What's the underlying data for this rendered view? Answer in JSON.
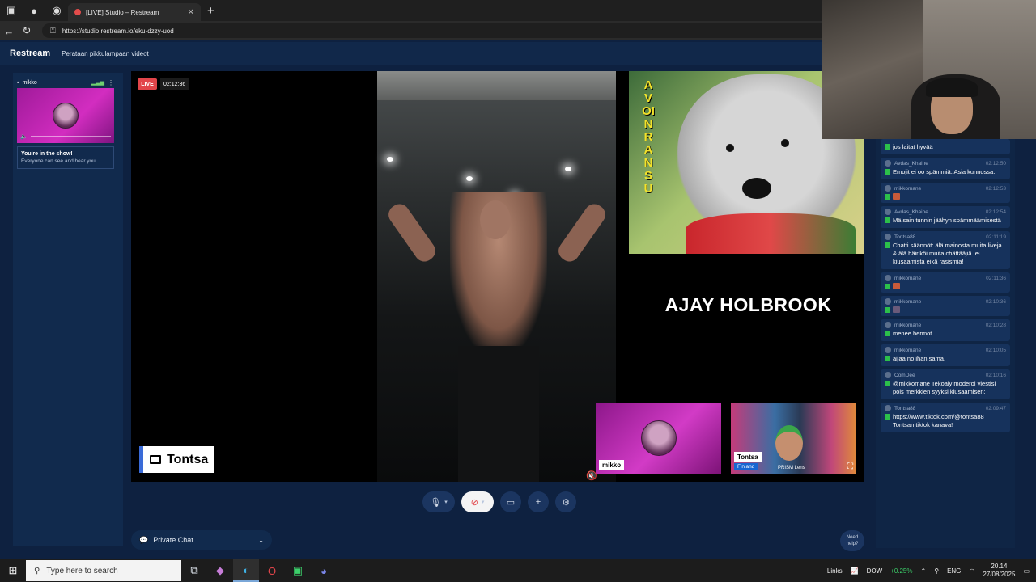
{
  "browser": {
    "tab_title": "[LIVE] Studio – Restream",
    "url": "https://studio.restream.io/eku-dzzy-uod"
  },
  "app": {
    "brand": "Restream",
    "show_title": "Perataan pikkulampaan videot"
  },
  "backstage": {
    "guest_name": "mikko",
    "notice_title": "You're in the show!",
    "notice_text": "Everyone can see and hear you."
  },
  "stage": {
    "live_label": "LIVE",
    "timer": "02:12:36",
    "poster_text": "AVOIN RANSU",
    "caption": "AJAY HOLBROOK",
    "screen_share_label": "Tontsa",
    "guests": [
      {
        "name": "mikko"
      },
      {
        "name": "Tontsa",
        "country": "Finland",
        "brand": "PRISM Lens"
      }
    ]
  },
  "controls": {
    "private_chat_label": "Private Chat",
    "need_help_label": "Need help?"
  },
  "chat": {
    "messages": [
      {
        "user": "",
        "time": "",
        "text": "jos laitat hyvää"
      },
      {
        "user": "Avdas_Khaine",
        "time": "02:12:50",
        "text": "Emojit ei oo spämmiä. Asia kunnossa."
      },
      {
        "user": "mikkomane",
        "time": "02:12:53",
        "text": "",
        "emoji": true
      },
      {
        "user": "Avdas_Khaine",
        "time": "02:12:54",
        "text": "Mä sain tunnin jäähyn spämmäämisestä"
      },
      {
        "user": "Tontsa88",
        "time": "02:11:19",
        "text": "Chatti säännöt: älä mainosta muita liveja & älä häiriköi muita chättääjiä. ei kiusaamista eikä rasismia!"
      },
      {
        "user": "mikkomane",
        "time": "02:11:36",
        "text": "",
        "emoji": true
      },
      {
        "user": "mikkomane",
        "time": "02:10:36",
        "text": "",
        "emoji": true
      },
      {
        "user": "mikkomane",
        "time": "02:10:28",
        "text": "menee hermot"
      },
      {
        "user": "mikkomane",
        "time": "02:10:05",
        "text": "aijaa no ihan sama."
      },
      {
        "user": "ComDee",
        "time": "02:10:16",
        "text": "@mikkomane Tekoäly moderoi viestisi pois merkkien syyksi kiusaamisen:"
      },
      {
        "user": "Tontsa88",
        "time": "02:09:47",
        "text": "https://www.tiktok.com/@tontsa88 Tontsan tiktok kanava!"
      }
    ]
  },
  "taskbar": {
    "search_placeholder": "Type here to search",
    "links_label": "Links",
    "ticker": "DOW",
    "ticker_change": "+0.25%",
    "language": "ENG",
    "time": "20.14",
    "date": "27/08/2025"
  },
  "colors": {
    "live_red": "#e2454a",
    "app_bg": "#0e2140",
    "panel": "#112a4d",
    "twitch_green": "#2cbf4a"
  }
}
